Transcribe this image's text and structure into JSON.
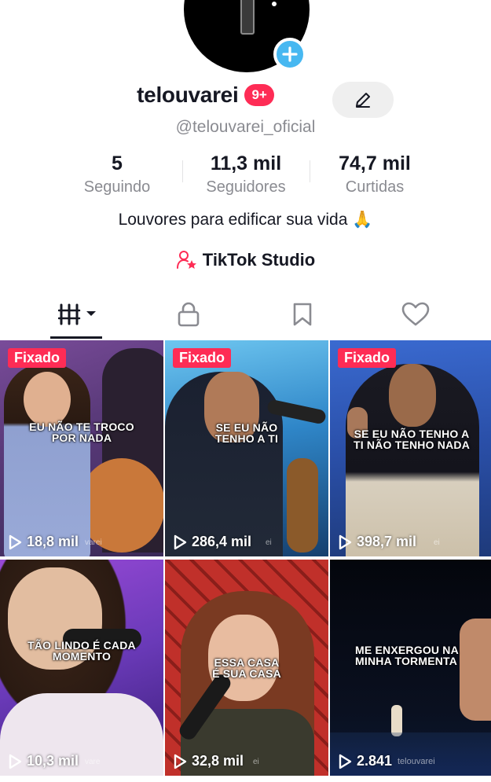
{
  "profile": {
    "username": "telouvarei",
    "notification_badge": "9+",
    "handle": "@telouvarei_oficial",
    "bio": "Louvores para edificar sua vida 🙏",
    "studio_label": "TikTok Studio",
    "icons": {
      "add": "plus-icon",
      "edit": "pencil-icon",
      "studio": "person-star-icon"
    }
  },
  "stats": [
    {
      "value": "5",
      "label": "Seguindo"
    },
    {
      "value": "11,3 mil",
      "label": "Seguidores"
    },
    {
      "value": "74,7 mil",
      "label": "Curtidas"
    }
  ],
  "tabs": [
    {
      "icon": "grid-dropdown-icon",
      "active": true
    },
    {
      "icon": "lock-icon",
      "active": false
    },
    {
      "icon": "bookmark-icon",
      "active": false
    },
    {
      "icon": "heart-icon",
      "active": false
    }
  ],
  "videos": [
    {
      "pinned": "Fixado",
      "caption_lines": [
        "EU NÃO TE TROCO",
        "POR NADA"
      ],
      "views": "18,8 mil",
      "watermark": "varei"
    },
    {
      "pinned": "Fixado",
      "caption_lines": [
        "SE EU NÃO",
        "TENHO A TI"
      ],
      "views": "286,4 mil",
      "watermark": "ei"
    },
    {
      "pinned": "Fixado",
      "caption_lines": [
        "SE EU NÃO TENHO A",
        "TI NÃO TENHO NADA"
      ],
      "views": "398,7 mil",
      "watermark": "ei"
    },
    {
      "pinned": "",
      "caption_lines": [
        "TÃO LINDO É CADA",
        "MOMENTO"
      ],
      "views": "10,3 mil",
      "watermark": "vare"
    },
    {
      "pinned": "",
      "caption_lines": [
        "ESSA CASA",
        "É SUA CASA"
      ],
      "views": "32,8 mil",
      "watermark": "ei"
    },
    {
      "pinned": "",
      "caption_lines": [
        "ME ENXERGOU NA",
        "MINHA TORMENTA"
      ],
      "views": "2.841",
      "watermark": "telouvarei"
    }
  ],
  "colors": {
    "accent": "#fe2c55",
    "add_badge": "#47b8f1",
    "text_primary": "#161823",
    "text_secondary": "#8a8b91"
  }
}
